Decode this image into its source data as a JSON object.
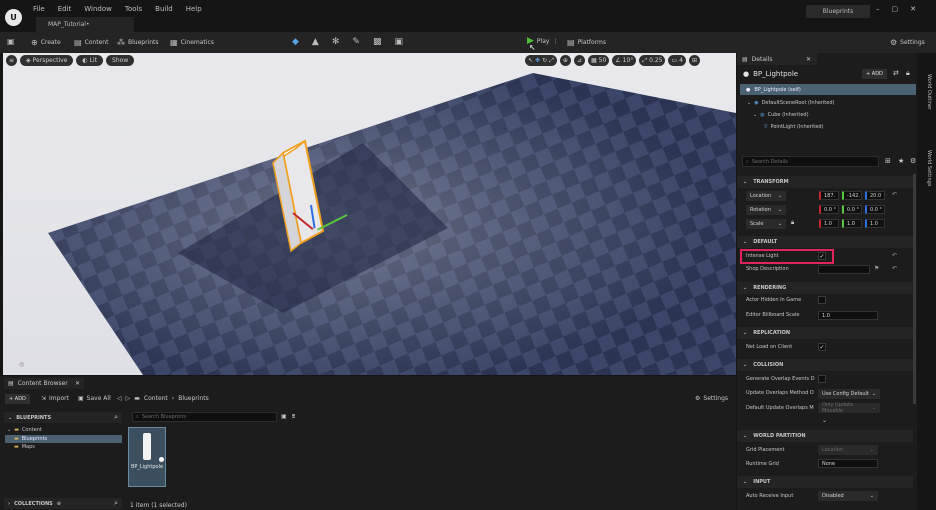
{
  "window": {
    "menu": [
      "File",
      "Edit",
      "Window",
      "Tools",
      "Build",
      "Help"
    ],
    "map_tab": "MAP_Tutorial•",
    "blueprints_label": "Blueprints",
    "controls": [
      "–",
      "▢",
      "✕"
    ]
  },
  "toolbar": {
    "create": "Create",
    "content": "Content",
    "blueprints": "Blueprints",
    "cinematics": "Cinematics",
    "play": "Play",
    "platforms": "Platforms",
    "settings": "Settings"
  },
  "viewport": {
    "perspective": "Perspective",
    "lit": "Lit",
    "show": "Show",
    "grid_snap": "50",
    "rotation_snap": "10°",
    "scale_snap": "0.25",
    "camera_speed": "4"
  },
  "details": {
    "tab_title": "Details",
    "actor_name": "BP_Lightpole",
    "add_label": "+ ADD",
    "component_tree": [
      "BP_Lightpole (self)",
      "DefaultSceneRoot (Inherited)",
      "Cube (Inherited)",
      "PointLight (Inherited)"
    ],
    "search_placeholder": "Search Details",
    "sections": {
      "transform": "TRANSFORM",
      "default": "DEFAULT",
      "rendering": "RENDERING",
      "replication": "REPLICATION",
      "collision": "COLLISION",
      "world_partition": "WORLD PARTITION",
      "input": "INPUT"
    },
    "transform": {
      "location_label": "Location",
      "location": [
        "187.",
        "-142.",
        "20.0"
      ],
      "rotation_label": "Rotation",
      "rotation": [
        "0.0 °",
        "0.0 °",
        "0.0 °"
      ],
      "scale_label": "Scale",
      "scale": [
        "1.0",
        "1.0",
        "1.0"
      ]
    },
    "default": {
      "intense_light_label": "Intense Light",
      "intense_light_checked": true,
      "shop_description_label": "Shop Description",
      "shop_description_value": ""
    },
    "rendering": {
      "actor_hidden_label": "Actor Hidden In Game",
      "billboard_scale_label": "Editor Billboard Scale",
      "billboard_scale_value": "1.0"
    },
    "replication": {
      "net_load_label": "Net Load on Client",
      "net_load_checked": true
    },
    "collision": {
      "gen_overlap_label": "Generate Overlap Events D",
      "update_overlap_label": "Update Overlaps Method D",
      "update_overlap_value": "Use Config Default",
      "default_update_label": "Default Update Overlaps M",
      "default_update_value": "Only Update Movable"
    },
    "world_partition": {
      "grid_placement_label": "Grid Placement",
      "grid_placement_value": "Location",
      "runtime_grid_label": "Runtime Grid",
      "runtime_grid_value": "None"
    },
    "input": {
      "auto_receive_label": "Auto Receive Input",
      "auto_receive_value": "Disabled"
    },
    "highlight_color": "#e0245e"
  },
  "side_tabs": [
    "World Outliner",
    "World Settings"
  ],
  "content_browser": {
    "tab_title": "Content Browser",
    "add_label": "+ ADD",
    "import_label": "Import",
    "save_all_label": "Save All",
    "breadcrumb": [
      "Content",
      "Blueprints"
    ],
    "settings_label": "Settings",
    "folder_header": "BLUEPRINTS",
    "tree": [
      "Content",
      "Blueprints",
      "Maps"
    ],
    "search_placeholder": "Search Blueprints",
    "assets": [
      {
        "name": "BP_Lightpole"
      }
    ],
    "status": "1 item (1 selected)",
    "collections_label": "COLLECTIONS"
  }
}
